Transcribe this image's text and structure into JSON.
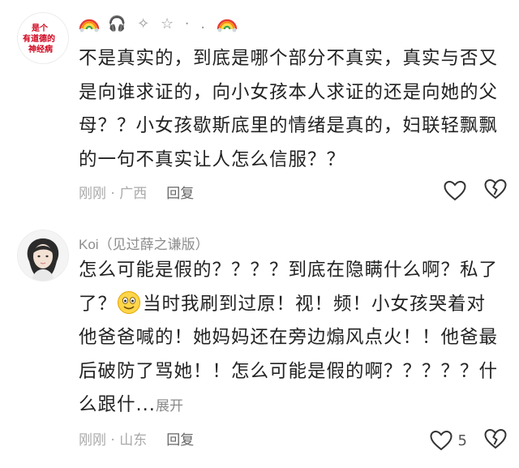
{
  "comments": [
    {
      "avatar_text": [
        "是个",
        "有道德的",
        "神经病"
      ],
      "author_deco": "🎧 ✧ ☆ · .",
      "text": "不是真实的，到底是哪个部分不真实，真实与否又是向谁求证的，向小女孩本人求证的还是向她的父母？？小女孩歇斯底里的情绪是真的，妇联轻飘飘的一句不真实让人怎么信服？？",
      "time": "刚刚",
      "location": "广西",
      "reply_label": "回复"
    },
    {
      "author": "Koi（见过薛之谦版）",
      "text_before_emoji": "怎么可能是假的？？？？到底在隐瞒什么啊？私了了？",
      "emoji_icon": "smiling-emoji-icon",
      "text_after_emoji": "当时我刷到过原！视！频！小女孩哭着对他爸爸喊的！她妈妈还在旁边煽风点火！！他爸最后破防了骂她！！怎么可能是假的啊？？？？？什么跟什...",
      "expand_label": "展开",
      "time": "刚刚",
      "location": "山东",
      "reply_label": "回复",
      "like_count": "5"
    }
  ],
  "colors": {
    "text": "#222222",
    "meta": "#a9a9a9",
    "avatar_text": "#d0021b"
  }
}
